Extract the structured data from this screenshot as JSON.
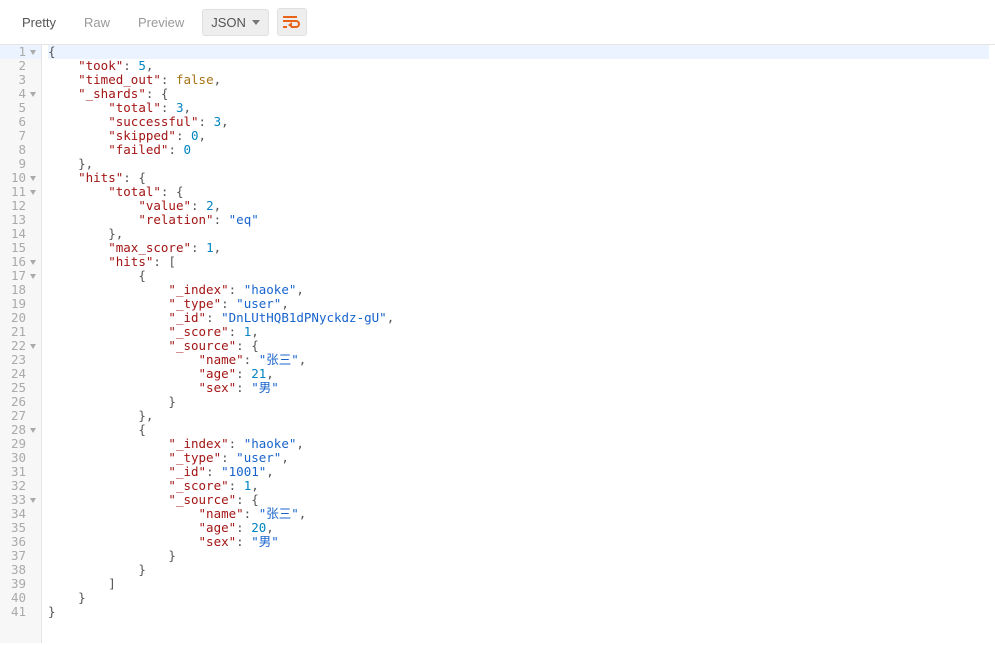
{
  "toolbar": {
    "pretty": "Pretty",
    "raw": "Raw",
    "preview": "Preview",
    "format_label": "JSON"
  },
  "code": {
    "lines": [
      {
        "n": 1,
        "fold": true,
        "t": [
          [
            "punct",
            "{"
          ]
        ]
      },
      {
        "n": 2,
        "fold": false,
        "t": [
          [
            "ind",
            1
          ],
          [
            "key",
            "\"took\""
          ],
          [
            "punct",
            ": "
          ],
          [
            "num",
            "5"
          ],
          [
            "punct",
            ","
          ]
        ]
      },
      {
        "n": 3,
        "fold": false,
        "t": [
          [
            "ind",
            1
          ],
          [
            "key",
            "\"timed_out\""
          ],
          [
            "punct",
            ": "
          ],
          [
            "bool",
            "false"
          ],
          [
            "punct",
            ","
          ]
        ]
      },
      {
        "n": 4,
        "fold": true,
        "t": [
          [
            "ind",
            1
          ],
          [
            "key",
            "\"_shards\""
          ],
          [
            "punct",
            ": {"
          ]
        ]
      },
      {
        "n": 5,
        "fold": false,
        "t": [
          [
            "ind",
            2
          ],
          [
            "key",
            "\"total\""
          ],
          [
            "punct",
            ": "
          ],
          [
            "num",
            "3"
          ],
          [
            "punct",
            ","
          ]
        ]
      },
      {
        "n": 6,
        "fold": false,
        "t": [
          [
            "ind",
            2
          ],
          [
            "key",
            "\"successful\""
          ],
          [
            "punct",
            ": "
          ],
          [
            "num",
            "3"
          ],
          [
            "punct",
            ","
          ]
        ]
      },
      {
        "n": 7,
        "fold": false,
        "t": [
          [
            "ind",
            2
          ],
          [
            "key",
            "\"skipped\""
          ],
          [
            "punct",
            ": "
          ],
          [
            "num",
            "0"
          ],
          [
            "punct",
            ","
          ]
        ]
      },
      {
        "n": 8,
        "fold": false,
        "t": [
          [
            "ind",
            2
          ],
          [
            "key",
            "\"failed\""
          ],
          [
            "punct",
            ": "
          ],
          [
            "num",
            "0"
          ]
        ]
      },
      {
        "n": 9,
        "fold": false,
        "t": [
          [
            "ind",
            1
          ],
          [
            "punct",
            "},"
          ]
        ]
      },
      {
        "n": 10,
        "fold": true,
        "t": [
          [
            "ind",
            1
          ],
          [
            "key",
            "\"hits\""
          ],
          [
            "punct",
            ": {"
          ]
        ]
      },
      {
        "n": 11,
        "fold": true,
        "t": [
          [
            "ind",
            2
          ],
          [
            "key",
            "\"total\""
          ],
          [
            "punct",
            ": {"
          ]
        ]
      },
      {
        "n": 12,
        "fold": false,
        "t": [
          [
            "ind",
            3
          ],
          [
            "key",
            "\"value\""
          ],
          [
            "punct",
            ": "
          ],
          [
            "num",
            "2"
          ],
          [
            "punct",
            ","
          ]
        ]
      },
      {
        "n": 13,
        "fold": false,
        "t": [
          [
            "ind",
            3
          ],
          [
            "key",
            "\"relation\""
          ],
          [
            "punct",
            ": "
          ],
          [
            "str",
            "\"eq\""
          ]
        ]
      },
      {
        "n": 14,
        "fold": false,
        "t": [
          [
            "ind",
            2
          ],
          [
            "punct",
            "},"
          ]
        ]
      },
      {
        "n": 15,
        "fold": false,
        "t": [
          [
            "ind",
            2
          ],
          [
            "key",
            "\"max_score\""
          ],
          [
            "punct",
            ": "
          ],
          [
            "num",
            "1"
          ],
          [
            "punct",
            ","
          ]
        ]
      },
      {
        "n": 16,
        "fold": true,
        "t": [
          [
            "ind",
            2
          ],
          [
            "key",
            "\"hits\""
          ],
          [
            "punct",
            ": ["
          ]
        ]
      },
      {
        "n": 17,
        "fold": true,
        "t": [
          [
            "ind",
            3
          ],
          [
            "punct",
            "{"
          ]
        ]
      },
      {
        "n": 18,
        "fold": false,
        "t": [
          [
            "ind",
            4
          ],
          [
            "key",
            "\"_index\""
          ],
          [
            "punct",
            ": "
          ],
          [
            "str",
            "\"haoke\""
          ],
          [
            "punct",
            ","
          ]
        ]
      },
      {
        "n": 19,
        "fold": false,
        "t": [
          [
            "ind",
            4
          ],
          [
            "key",
            "\"_type\""
          ],
          [
            "punct",
            ": "
          ],
          [
            "str",
            "\"user\""
          ],
          [
            "punct",
            ","
          ]
        ]
      },
      {
        "n": 20,
        "fold": false,
        "t": [
          [
            "ind",
            4
          ],
          [
            "key",
            "\"_id\""
          ],
          [
            "punct",
            ": "
          ],
          [
            "str",
            "\"DnLUtHQB1dPNyckdz-gU\""
          ],
          [
            "punct",
            ","
          ]
        ]
      },
      {
        "n": 21,
        "fold": false,
        "t": [
          [
            "ind",
            4
          ],
          [
            "key",
            "\"_score\""
          ],
          [
            "punct",
            ": "
          ],
          [
            "num",
            "1"
          ],
          [
            "punct",
            ","
          ]
        ]
      },
      {
        "n": 22,
        "fold": true,
        "t": [
          [
            "ind",
            4
          ],
          [
            "key",
            "\"_source\""
          ],
          [
            "punct",
            ": {"
          ]
        ]
      },
      {
        "n": 23,
        "fold": false,
        "t": [
          [
            "ind",
            5
          ],
          [
            "key",
            "\"name\""
          ],
          [
            "punct",
            ": "
          ],
          [
            "str",
            "\"张三\""
          ],
          [
            "punct",
            ","
          ]
        ]
      },
      {
        "n": 24,
        "fold": false,
        "t": [
          [
            "ind",
            5
          ],
          [
            "key",
            "\"age\""
          ],
          [
            "punct",
            ": "
          ],
          [
            "num",
            "21"
          ],
          [
            "punct",
            ","
          ]
        ]
      },
      {
        "n": 25,
        "fold": false,
        "t": [
          [
            "ind",
            5
          ],
          [
            "key",
            "\"sex\""
          ],
          [
            "punct",
            ": "
          ],
          [
            "str",
            "\"男\""
          ]
        ]
      },
      {
        "n": 26,
        "fold": false,
        "t": [
          [
            "ind",
            4
          ],
          [
            "punct",
            "}"
          ]
        ]
      },
      {
        "n": 27,
        "fold": false,
        "t": [
          [
            "ind",
            3
          ],
          [
            "punct",
            "},"
          ]
        ]
      },
      {
        "n": 28,
        "fold": true,
        "t": [
          [
            "ind",
            3
          ],
          [
            "punct",
            "{"
          ]
        ]
      },
      {
        "n": 29,
        "fold": false,
        "t": [
          [
            "ind",
            4
          ],
          [
            "key",
            "\"_index\""
          ],
          [
            "punct",
            ": "
          ],
          [
            "str",
            "\"haoke\""
          ],
          [
            "punct",
            ","
          ]
        ]
      },
      {
        "n": 30,
        "fold": false,
        "t": [
          [
            "ind",
            4
          ],
          [
            "key",
            "\"_type\""
          ],
          [
            "punct",
            ": "
          ],
          [
            "str",
            "\"user\""
          ],
          [
            "punct",
            ","
          ]
        ]
      },
      {
        "n": 31,
        "fold": false,
        "t": [
          [
            "ind",
            4
          ],
          [
            "key",
            "\"_id\""
          ],
          [
            "punct",
            ": "
          ],
          [
            "str",
            "\"1001\""
          ],
          [
            "punct",
            ","
          ]
        ]
      },
      {
        "n": 32,
        "fold": false,
        "t": [
          [
            "ind",
            4
          ],
          [
            "key",
            "\"_score\""
          ],
          [
            "punct",
            ": "
          ],
          [
            "num",
            "1"
          ],
          [
            "punct",
            ","
          ]
        ]
      },
      {
        "n": 33,
        "fold": true,
        "t": [
          [
            "ind",
            4
          ],
          [
            "key",
            "\"_source\""
          ],
          [
            "punct",
            ": {"
          ]
        ]
      },
      {
        "n": 34,
        "fold": false,
        "t": [
          [
            "ind",
            5
          ],
          [
            "key",
            "\"name\""
          ],
          [
            "punct",
            ": "
          ],
          [
            "str",
            "\"张三\""
          ],
          [
            "punct",
            ","
          ]
        ]
      },
      {
        "n": 35,
        "fold": false,
        "t": [
          [
            "ind",
            5
          ],
          [
            "key",
            "\"age\""
          ],
          [
            "punct",
            ": "
          ],
          [
            "num",
            "20"
          ],
          [
            "punct",
            ","
          ]
        ]
      },
      {
        "n": 36,
        "fold": false,
        "t": [
          [
            "ind",
            5
          ],
          [
            "key",
            "\"sex\""
          ],
          [
            "punct",
            ": "
          ],
          [
            "str",
            "\"男\""
          ]
        ]
      },
      {
        "n": 37,
        "fold": false,
        "t": [
          [
            "ind",
            4
          ],
          [
            "punct",
            "}"
          ]
        ]
      },
      {
        "n": 38,
        "fold": false,
        "t": [
          [
            "ind",
            3
          ],
          [
            "punct",
            "}"
          ]
        ]
      },
      {
        "n": 39,
        "fold": false,
        "t": [
          [
            "ind",
            2
          ],
          [
            "punct",
            "]"
          ]
        ]
      },
      {
        "n": 40,
        "fold": false,
        "t": [
          [
            "ind",
            1
          ],
          [
            "punct",
            "}"
          ]
        ]
      },
      {
        "n": 41,
        "fold": false,
        "t": [
          [
            "punct",
            "}"
          ]
        ]
      }
    ]
  }
}
